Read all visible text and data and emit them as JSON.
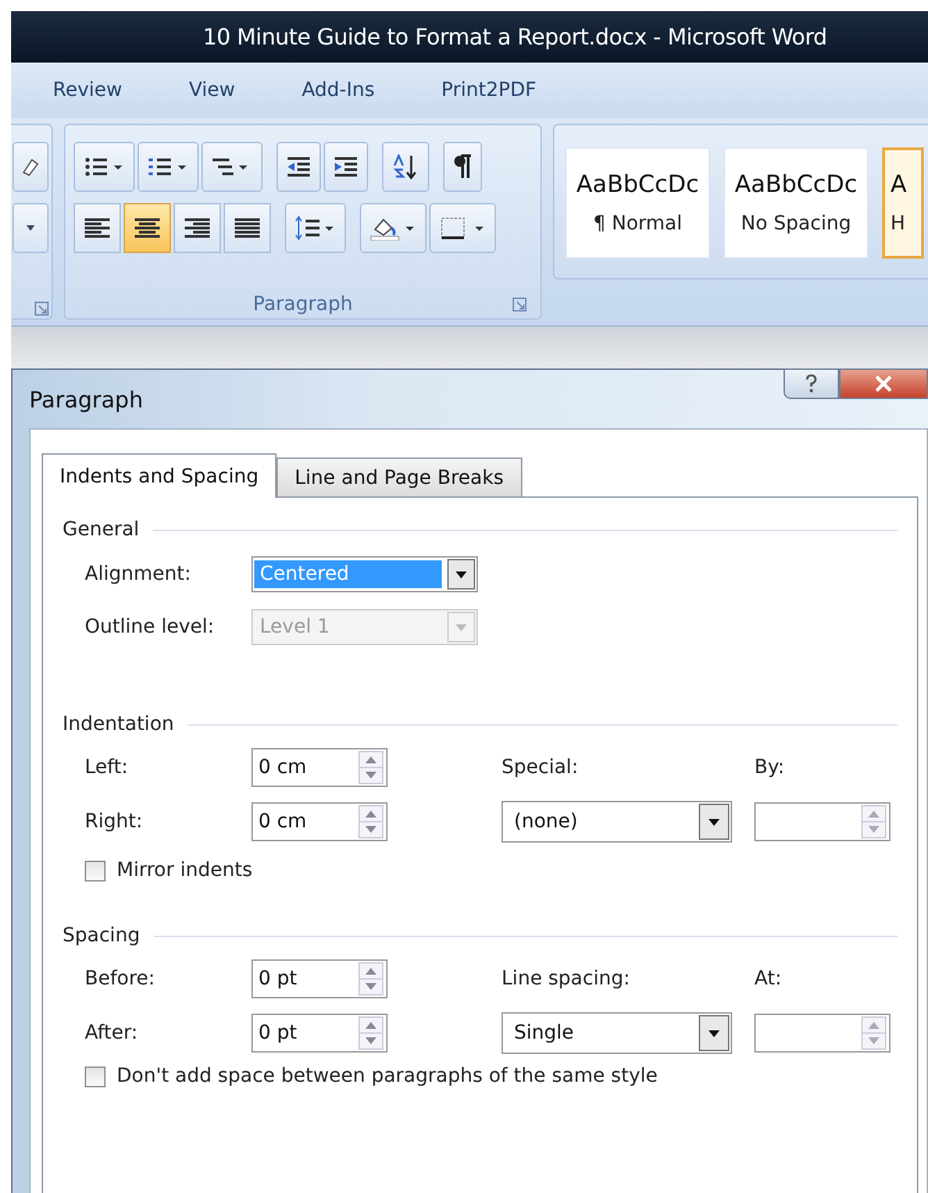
{
  "window": {
    "title": "10 Minute Guide to Format a Report.docx - Microsoft Word"
  },
  "ribbon_tabs": [
    {
      "label": "Review"
    },
    {
      "label": "View"
    },
    {
      "label": "Add-Ins"
    },
    {
      "label": "Print2PDF"
    }
  ],
  "paragraph_group": {
    "label": "Paragraph",
    "alignment_buttons": [
      {
        "selected": false
      },
      {
        "selected": true
      },
      {
        "selected": false
      },
      {
        "selected": false
      }
    ]
  },
  "styles": [
    {
      "preview": "AaBbCcDc",
      "name": "¶ Normal",
      "selected": false
    },
    {
      "preview": "AaBbCcDc",
      "name": "No Spacing",
      "selected": false
    },
    {
      "preview": "A",
      "name": "H",
      "selected": true
    }
  ],
  "dialog": {
    "title": "Paragraph",
    "tabs": [
      {
        "label": "Indents and Spacing",
        "selected": true
      },
      {
        "label": "Line and Page Breaks",
        "selected": false
      }
    ],
    "general": {
      "heading": "General",
      "fields": [
        {
          "label": "Alignment:",
          "value": "Centered",
          "disabled": false
        },
        {
          "label": "Outline level:",
          "value": "Level 1",
          "disabled": true
        }
      ]
    },
    "indentation": {
      "heading": "Indentation",
      "left": {
        "label": "Left:",
        "value": "0 cm"
      },
      "right": {
        "label": "Right:",
        "value": "0 cm"
      },
      "special": {
        "label": "Special:",
        "value": "(none)"
      },
      "by": {
        "label": "By:"
      },
      "mirror": {
        "label": "Mirror indents",
        "checked": false
      }
    },
    "spacing": {
      "heading": "Spacing",
      "before": {
        "label": "Before:",
        "value": "0 pt"
      },
      "after": {
        "label": "After:",
        "value": "0 pt"
      },
      "line_spacing": {
        "label": "Line spacing:",
        "value": "Single"
      },
      "at": {
        "label": "At:"
      },
      "dont_add": {
        "label": "Don't add space between paragraphs of the same style",
        "checked": false
      }
    }
  }
}
